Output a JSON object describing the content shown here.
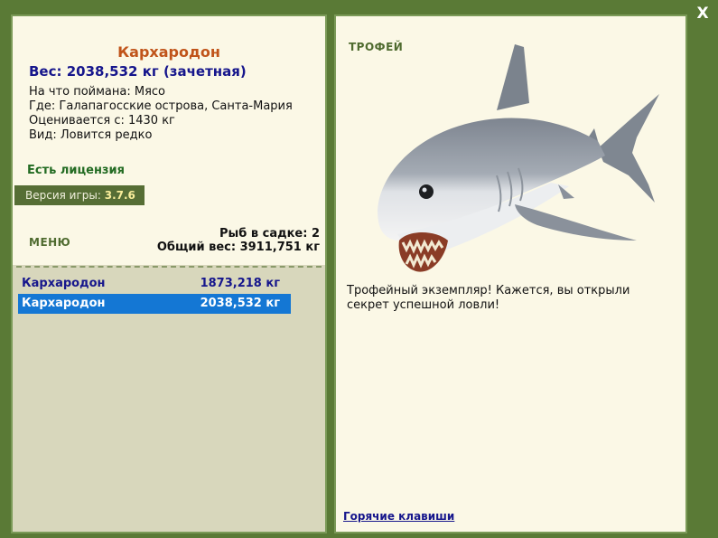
{
  "close_label": "X",
  "fish": {
    "name": "Кархародон",
    "weight": "Вес: 2038,532 кг (зачетная)",
    "caught_on": "На что поймана: Мясо",
    "location": "Где: Галапагосские острова, Санта-Мария",
    "valued_from": "Оценивается с: 1430 кг",
    "kind": "Вид: Ловится редко"
  },
  "license": "Есть лицензия",
  "version": {
    "label": "Версия игры:",
    "value": "3.7.6"
  },
  "menu_label": "МЕНЮ",
  "stats": {
    "in_keepnet": "Рыб в садке: 2",
    "total_weight": "Общий вес: 3911,751 кг"
  },
  "fish_list": [
    {
      "name": "Кархародон",
      "weight": "1873,218 кг",
      "selected": false
    },
    {
      "name": "Кархародон",
      "weight": "2038,532 кг",
      "selected": true
    }
  ],
  "trophy_label": "ТРОФЕЙ",
  "description": "Трофейный экземпляр! Кажется, вы открыли секрет успешной ловли!",
  "hotkeys_label": "Горячие клавиши",
  "icons": {
    "close": "close-icon",
    "shark": "shark-image"
  },
  "colors": {
    "background": "#5a7a36",
    "panel": "#fbf8e6",
    "selection": "#1477d4",
    "title": "#c0541a",
    "link": "#16168c"
  }
}
